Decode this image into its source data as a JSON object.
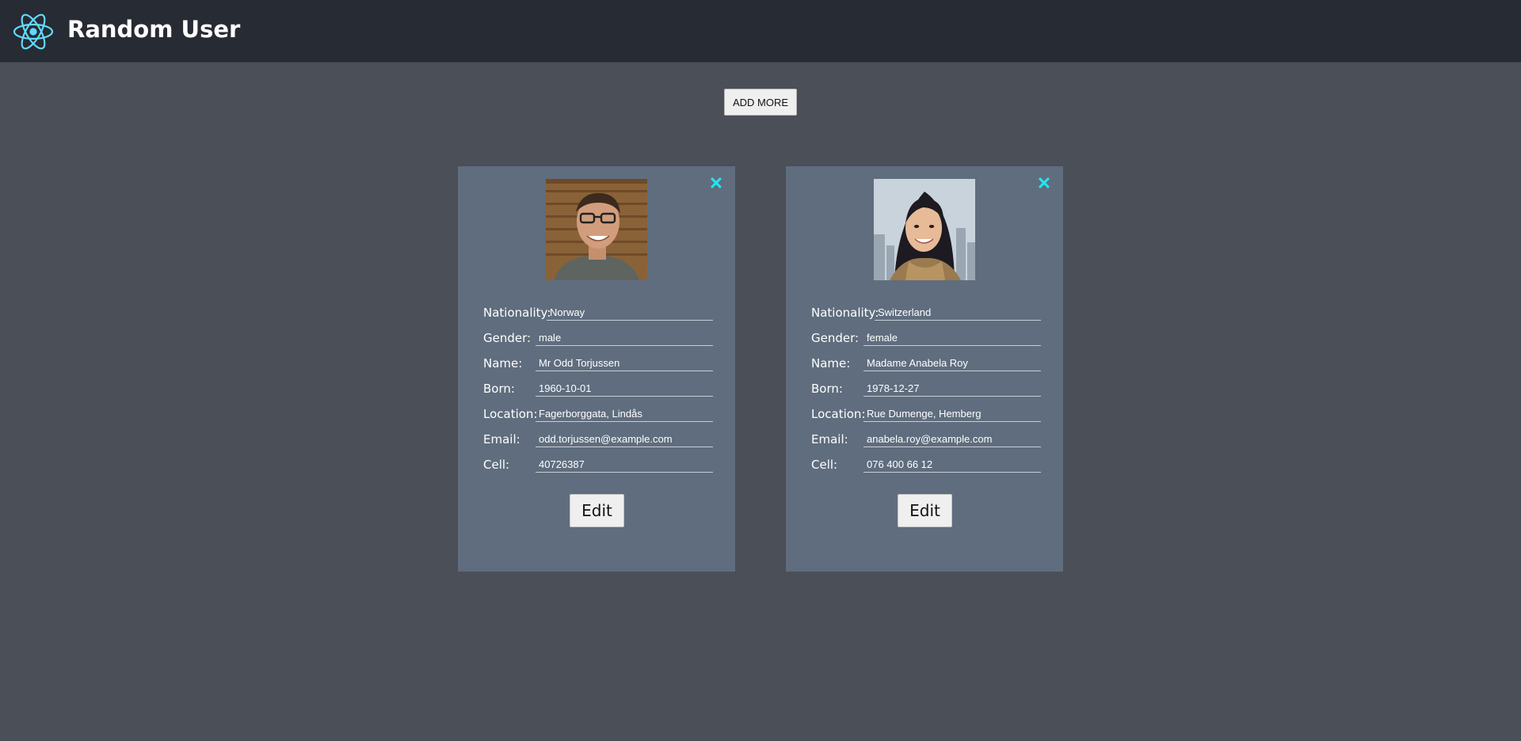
{
  "header": {
    "title": "Random User",
    "logo_icon": "react-logo-icon",
    "background": "#272b33",
    "accent": "#61dafb"
  },
  "toolbar": {
    "add_more_label": "ADD MORE"
  },
  "labels": {
    "nationality": "Nationality:",
    "gender": "Gender:",
    "name": "Name:",
    "born": "Born:",
    "location": "Location:",
    "email": "Email:",
    "cell": "Cell:",
    "edit": "Edit",
    "close": "✕"
  },
  "users": [
    {
      "nationality": "Norway",
      "gender": "male",
      "name": "Mr Odd Torjussen",
      "born": "1960-10-01",
      "location": "Fagerborggata, Lindås",
      "email": "odd.torjussen@example.com",
      "cell": "40726387"
    },
    {
      "nationality": "Switzerland",
      "gender": "female",
      "name": "Madame Anabela Roy",
      "born": "1978-12-27",
      "location": "Rue Dumenge, Hemberg",
      "email": "anabela.roy@example.com",
      "cell": "076 400 66 12"
    }
  ],
  "colors": {
    "page_bg": "#4a4f58",
    "card_bg": "#5f6d7e",
    "close_icon": "#22e6f0"
  }
}
